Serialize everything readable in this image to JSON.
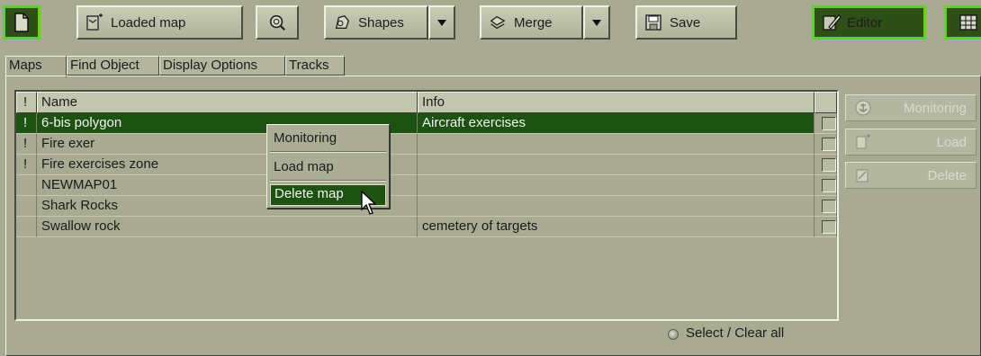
{
  "toolbar": {
    "loaded_map_label": "Loaded map",
    "shapes_label": "Shapes",
    "merge_label": "Merge",
    "save_label": "Save",
    "editor_label": "Editor"
  },
  "tabs": [
    {
      "label": "Maps",
      "active": true
    },
    {
      "label": "Find Object",
      "active": false
    },
    {
      "label": "Display Options",
      "active": false
    },
    {
      "label": "Tracks",
      "active": false
    }
  ],
  "table": {
    "columns": {
      "flag": "!",
      "name": "Name",
      "info": "Info"
    },
    "rows": [
      {
        "flag": "!",
        "name": "6-bis polygon",
        "info": "Aircraft exercises",
        "selected": true
      },
      {
        "flag": "!",
        "name": "Fire exer",
        "info": "",
        "selected": false
      },
      {
        "flag": "!",
        "name": "Fire exercises zone",
        "info": "",
        "selected": false
      },
      {
        "flag": "",
        "name": "NEWMAP01",
        "info": "",
        "selected": false
      },
      {
        "flag": "",
        "name": "Shark Rocks",
        "info": "",
        "selected": false
      },
      {
        "flag": "",
        "name": "Swallow rock",
        "info": "cemetery of targets",
        "selected": false
      }
    ]
  },
  "context_menu": {
    "items": [
      "Monitoring",
      "Load map",
      "Delete map"
    ],
    "highlighted": "Delete map"
  },
  "side_buttons": {
    "monitoring": "Monitoring",
    "load": "Load",
    "delete": "Delete"
  },
  "select_clear_label": "Select / Clear all",
  "colors": {
    "panel_bg": "#a8ab92",
    "selection": "#1e5212",
    "editor_accent": "#5fd02e"
  }
}
